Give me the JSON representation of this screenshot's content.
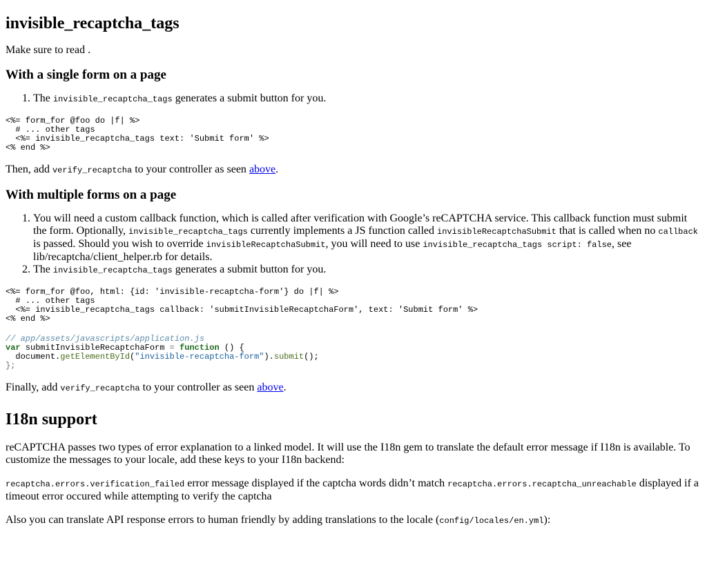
{
  "title": "invisible_recaptcha_tags",
  "intro": "Make sure to read .",
  "single_form": {
    "heading": "With a single form on a page",
    "step1_pre": "The ",
    "step1_code": "invisible_recaptcha_tags",
    "step1_post": " generates a submit button for you.",
    "code": "<%= form_for @foo do |f| %>\n  # ... other tags\n  <%= invisible_recaptcha_tags text: 'Submit form' %>\n<% end %>",
    "then_pre": "Then, add ",
    "then_code": "verify_recaptcha",
    "then_mid": " to your controller as seen ",
    "then_link": "above",
    "then_post": "."
  },
  "multi_form": {
    "heading": "With multiple forms on a page",
    "step1_a": "You will need a custom callback function, which is called after verification with Google’s reCAPTCHA service. This callback function must submit the form. Optionally, ",
    "step1_code1": "invisible_recaptcha_tags",
    "step1_b": " currently implements a JS function called ",
    "step1_code2": "invisibleRecaptchaSubmit",
    "step1_c": " that is called when no ",
    "step1_code3": "callback",
    "step1_d": " is passed. Should you wish to override ",
    "step1_code4": "invisibleRecaptchaSubmit",
    "step1_e": ", you will need to use ",
    "step1_code5": "invisible_recaptcha_tags script: false",
    "step1_f": ", see lib/recaptcha/client_helper.rb for details.",
    "step2_pre": "The ",
    "step2_code": "invisible_recaptcha_tags",
    "step2_post": " generates a submit button for you.",
    "code_erb": "<%= form_for @foo, html: {id: 'invisible-recaptcha-form'} do |f| %>\n  # ... other tags\n  <%= invisible_recaptcha_tags callback: 'submitInvisibleRecaptchaForm', text: 'Submit form' %>\n<% end %>",
    "js": {
      "comment": "// app/assets/javascripts/application.js",
      "kw_var": "var",
      "var_name": " submitInvisibleRecaptchaForm ",
      "eq": "=",
      "kw_function": "function",
      "parens": " () {",
      "doc": "document",
      "dot1": ".",
      "getel": "getElementById",
      "open": "(",
      "str": "\"invisible-recaptcha-form\"",
      "close": ").",
      "submit": "submit",
      "end_call": "();",
      "closing": "};"
    },
    "finally_pre": "Finally, add ",
    "finally_code": "verify_recaptcha",
    "finally_mid": " to your controller as seen ",
    "finally_link": "above",
    "finally_post": "."
  },
  "i18n": {
    "heading": "I18n support",
    "para1": "reCAPTCHA passes two types of error explanation to a linked model. It will use the I18n gem to translate the default error message if I18n is available. To customize the messages to your locale, add these keys to your I18n backend:",
    "key1": "recaptcha.errors.verification_failed",
    "key1_desc": " error message displayed if the captcha words didn’t match ",
    "key2": "recaptcha.errors.recaptcha_unreachable",
    "key2_desc": " displayed if a timeout error occured while attempting to verify the captcha",
    "para3_pre": "Also you can translate API response errors to human friendly by adding translations to the locale (",
    "para3_code": "config/locales/en.yml",
    "para3_post": "):"
  }
}
